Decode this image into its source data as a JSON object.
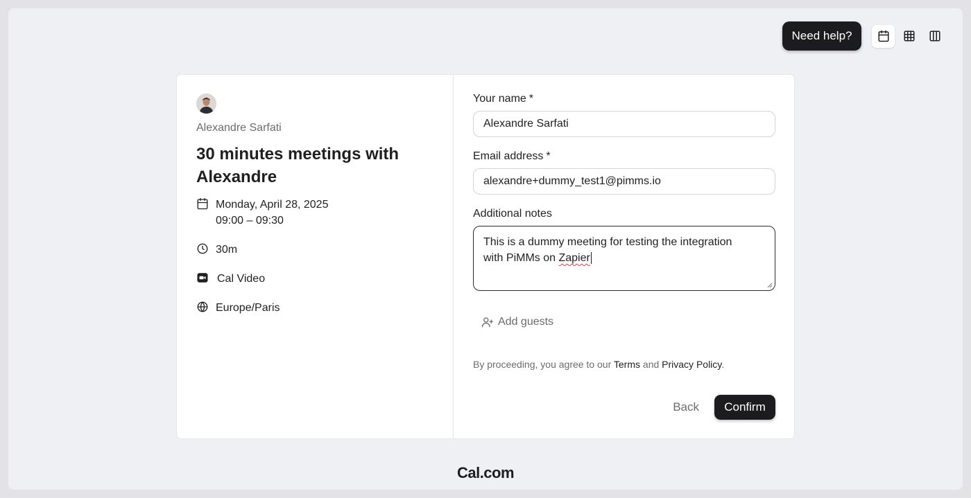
{
  "header": {
    "help_label": "Need help?",
    "view_icons": [
      "calendar-icon",
      "grid-icon",
      "columns-icon"
    ]
  },
  "host": {
    "name": "Alexandre Sarfati"
  },
  "event": {
    "title": "30 minutes meetings with Alexandre",
    "date": "Monday, April 28, 2025",
    "time": "09:00 – 09:30",
    "duration": "30m",
    "location": "Cal Video",
    "timezone": "Europe/Paris"
  },
  "form": {
    "name_label": "Your name",
    "name_value": "Alexandre Sarfati",
    "email_label": "Email address",
    "email_value": "alexandre+dummy_test1@pimms.io",
    "required_mark": "*",
    "notes_label": "Additional notes",
    "notes_line1": "This is a dummy meeting for testing the integration",
    "notes_line2_prefix": "with PiMMs on ",
    "notes_line2_word": "Zapier",
    "add_guests_label": "Add guests",
    "legal_prefix": "By proceeding, you agree to our ",
    "legal_terms": "Terms",
    "legal_and": " and ",
    "legal_privacy": "Privacy Policy",
    "legal_suffix": "."
  },
  "actions": {
    "back_label": "Back",
    "confirm_label": "Confirm"
  },
  "footer": {
    "brand": "Cal.com"
  },
  "colors": {
    "background": "#eff0f3",
    "primary_button": "#1c1c1e",
    "muted_text": "#6b6b70"
  }
}
